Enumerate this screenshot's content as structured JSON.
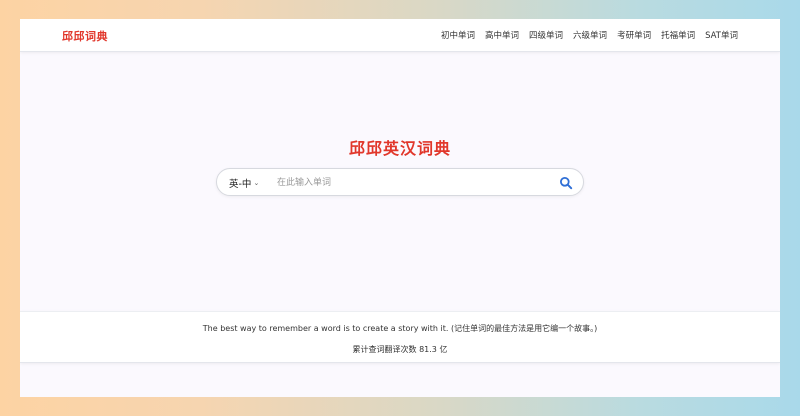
{
  "header": {
    "logo": "邱邱词典",
    "nav": [
      {
        "label": "初中单词"
      },
      {
        "label": "高中单词"
      },
      {
        "label": "四级单词"
      },
      {
        "label": "六级单词"
      },
      {
        "label": "考研单词"
      },
      {
        "label": "托福单词"
      },
      {
        "label": "SAT单词"
      }
    ]
  },
  "main": {
    "title": "邱邱英汉词典",
    "search": {
      "lang": "英-中",
      "value": "",
      "placeholder": "在此输入单词",
      "icon": "search-icon"
    }
  },
  "footer": {
    "tip": "The best way to remember a word is to create a story with it. (记住单词的最佳方法是用它编一个故事。)",
    "count": "累计查词翻译次数 81.3 亿"
  },
  "colors": {
    "brand": "#e1372b",
    "search_icon": "#2f6fd6"
  }
}
